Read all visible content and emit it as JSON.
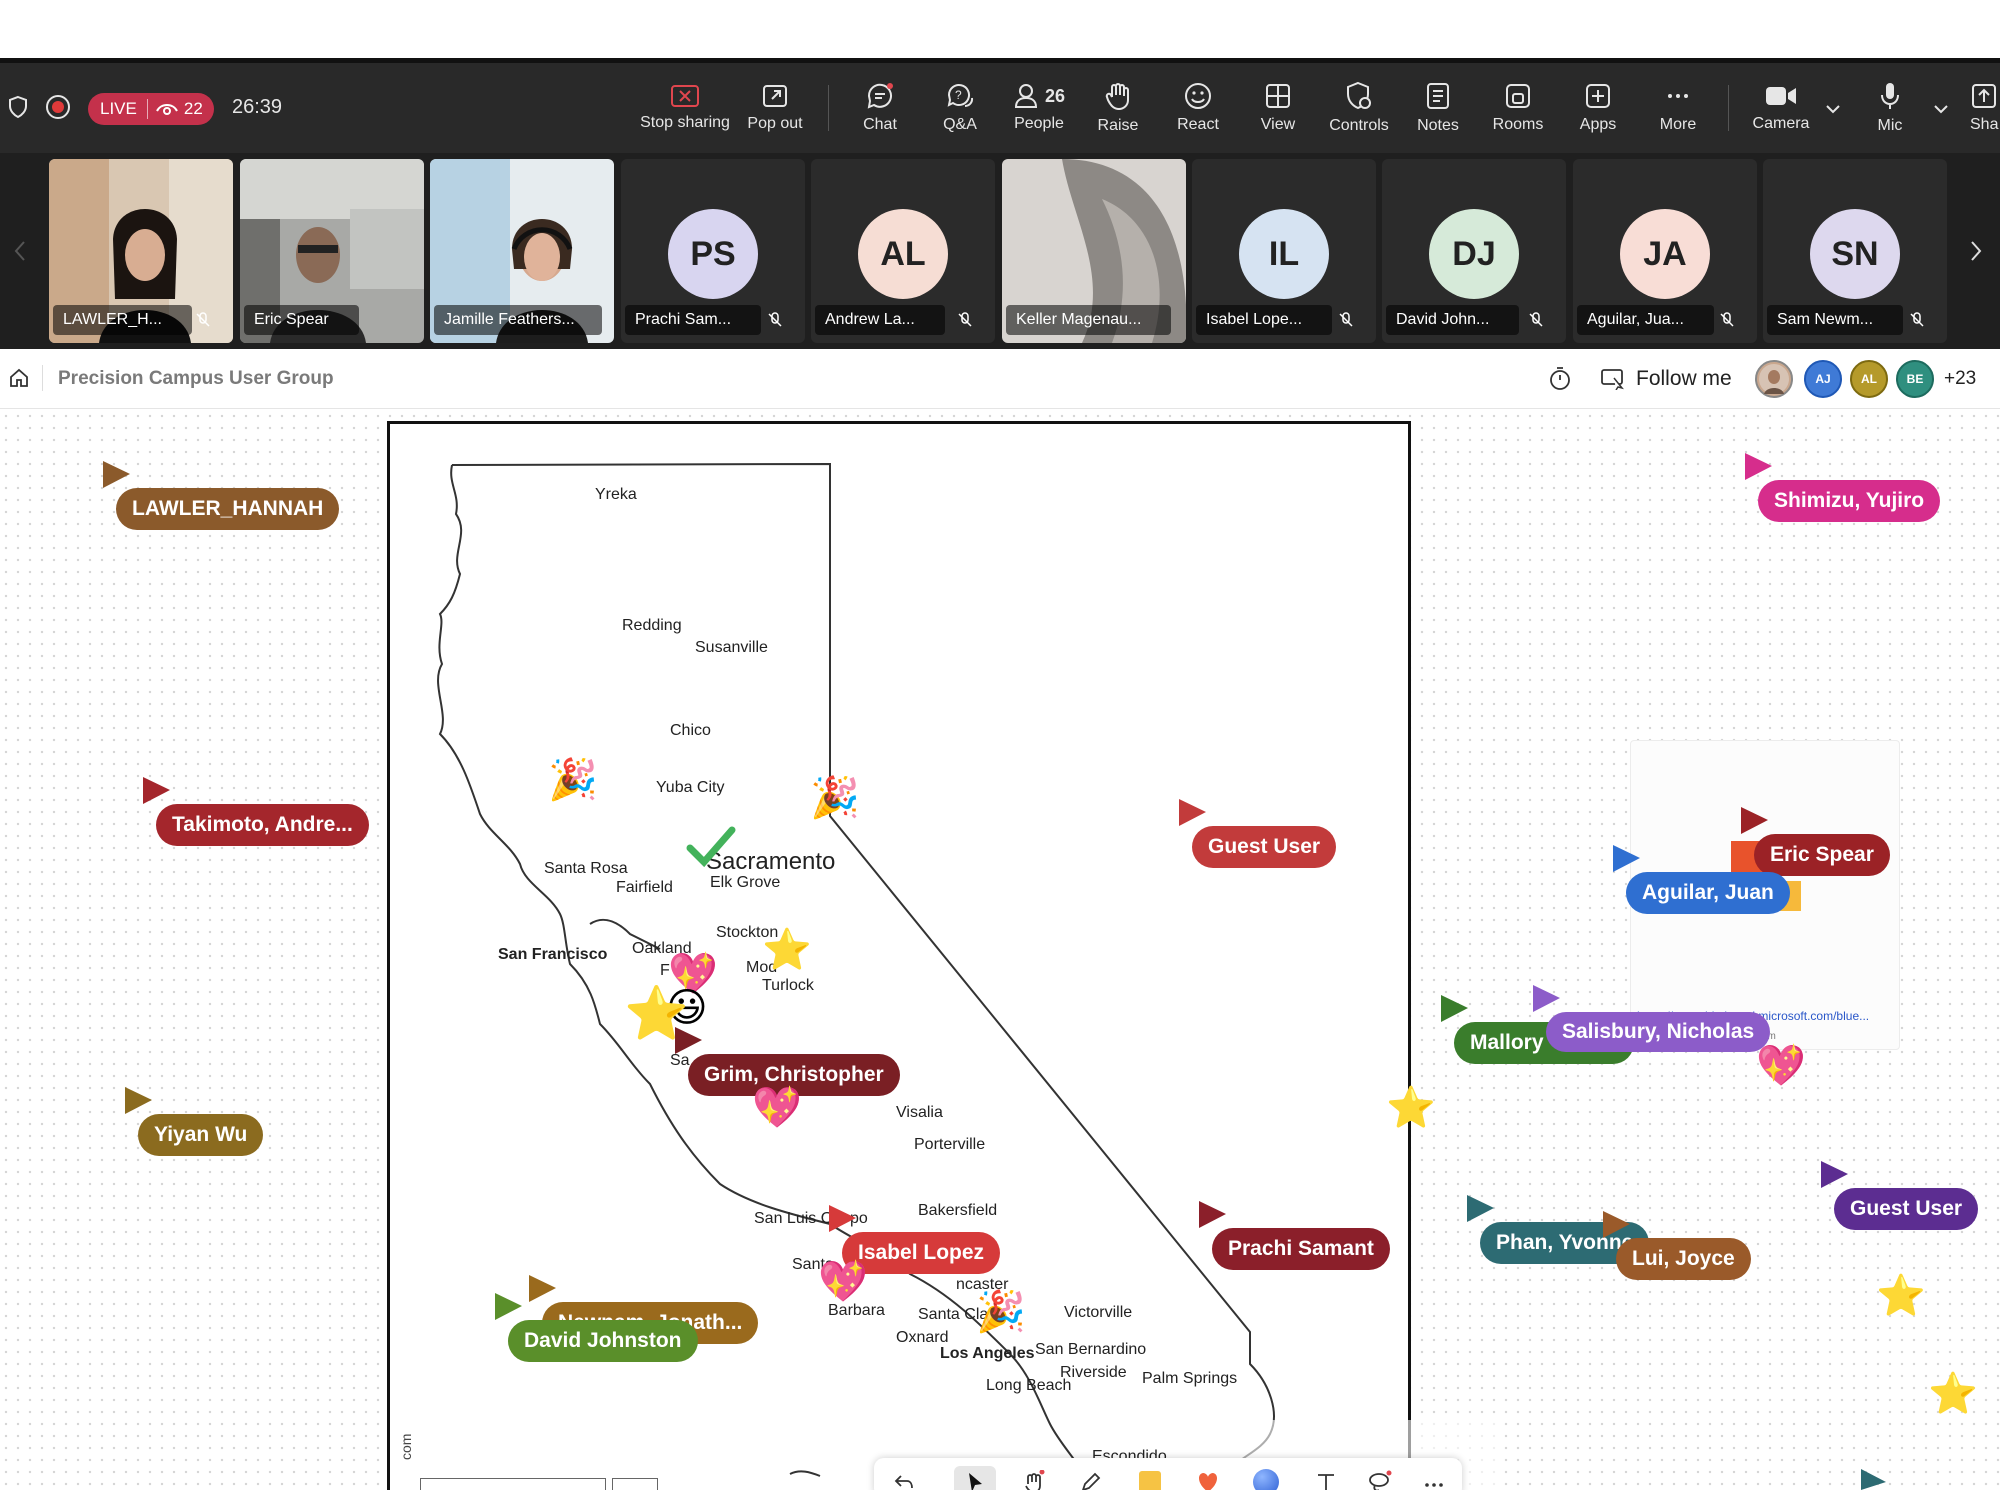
{
  "toolbar": {
    "live_label": "LIVE",
    "viewer_count": "22",
    "timer": "26:39",
    "buttons": {
      "stop_sharing": "Stop sharing",
      "pop_out": "Pop out",
      "chat": "Chat",
      "qa": "Q&A",
      "people": "People",
      "people_count": "26",
      "raise": "Raise",
      "react": "React",
      "view": "View",
      "controls": "Controls",
      "notes": "Notes",
      "rooms": "Rooms",
      "apps": "Apps",
      "more": "More",
      "camera": "Camera",
      "mic": "Mic",
      "share": "Sha"
    }
  },
  "participants": [
    {
      "name": "LAWLER_H...",
      "type": "video"
    },
    {
      "name": "Eric Spear",
      "type": "video"
    },
    {
      "name": "Jamille Feathers...",
      "type": "video"
    },
    {
      "name": "Prachi Sam...",
      "initials": "PS",
      "type": "avatar",
      "color": "#d8d5f0"
    },
    {
      "name": "Andrew La...",
      "initials": "AL",
      "type": "avatar",
      "color": "#f6ddd4"
    },
    {
      "name": "Keller Magenau...",
      "type": "video"
    },
    {
      "name": "Isabel Lope...",
      "initials": "IL",
      "type": "avatar",
      "color": "#d6e3f2"
    },
    {
      "name": "David John...",
      "initials": "DJ",
      "type": "avatar",
      "color": "#d6ead9"
    },
    {
      "name": "Aguilar, Jua...",
      "initials": "JA",
      "type": "avatar",
      "color": "#f8ddd6"
    },
    {
      "name": "Sam Newm...",
      "initials": "SN",
      "type": "avatar",
      "color": "#ddd8ee"
    }
  ],
  "breadcrumb": {
    "title": "Precision Campus User Group",
    "follow_me": "Follow me",
    "avatars": [
      "AJ",
      "AL",
      "BE"
    ],
    "more_count": "+23"
  },
  "map": {
    "cities": [
      {
        "label": "Yreka"
      },
      {
        "label": "Redding"
      },
      {
        "label": "Susanville"
      },
      {
        "label": "Chico"
      },
      {
        "label": "Yuba City"
      },
      {
        "label": "Sacramento"
      },
      {
        "label": "Elk Grove"
      },
      {
        "label": "Santa Rosa"
      },
      {
        "label": "Fairfield"
      },
      {
        "label": "Stockton"
      },
      {
        "label": "San Francisco"
      },
      {
        "label": "Oakland"
      },
      {
        "label": "Mod"
      },
      {
        "label": "Turlock"
      },
      {
        "label": "F"
      },
      {
        "label": "Sa"
      },
      {
        "label": "Visalia"
      },
      {
        "label": "Porterville"
      },
      {
        "label": "Bakersfield"
      },
      {
        "label": "San Luis O"
      },
      {
        "label": "po"
      },
      {
        "label": "Santa"
      },
      {
        "label": "ncaster"
      },
      {
        "label": "Barbara"
      },
      {
        "label": "Santa Cla"
      },
      {
        "label": "Victorville"
      },
      {
        "label": "Oxnard"
      },
      {
        "label": "Los Angeles"
      },
      {
        "label": "San Bernardino"
      },
      {
        "label": "Riverside"
      },
      {
        "label": "Long Beach"
      },
      {
        "label": "Palm Springs"
      },
      {
        "label": "Escondido"
      }
    ]
  },
  "cursors": [
    {
      "name": "LAWLER_HANNAH",
      "color": "#8b5a2b"
    },
    {
      "name": "Takimoto, Andre...",
      "color": "#a4262c"
    },
    {
      "name": "Yiyan Wu",
      "color": "#8b6b1f"
    },
    {
      "name": "Shimizu, Yujiro",
      "color": "#d62d8c"
    },
    {
      "name": "Guest User",
      "color": "#c23b3b"
    },
    {
      "name": "Eric Spear",
      "color": "#9b2226"
    },
    {
      "name": "Aguilar, Juan",
      "color": "#2f6fd1"
    },
    {
      "name": "Mallory",
      "color": "#3a7d2c"
    },
    {
      "name": "Salisbury, Nicholas",
      "color": "#8c5cc9"
    },
    {
      "name": "Grim, Christopher",
      "color": "#7a1f24"
    },
    {
      "name": "Isabel Lopez",
      "color": "#d63a3a"
    },
    {
      "name": "Prachi Samant",
      "color": "#8b1f2a"
    },
    {
      "name": "Newnam, Jonath...",
      "color": "#9a6a1d"
    },
    {
      "name": "David Johnston",
      "color": "#5a8f2a"
    },
    {
      "name": "Phan, Yvonne",
      "color": "#2d6b73"
    },
    {
      "name": "Lui, Joyce",
      "color": "#9a5a2a"
    },
    {
      "name": "Guest User",
      "color": "#5c2d91"
    }
  ],
  "link_card": {
    "url": "https://app.whiteboard.microsoft.com/blue...",
    "sub": "com"
  },
  "scale_text": "com"
}
